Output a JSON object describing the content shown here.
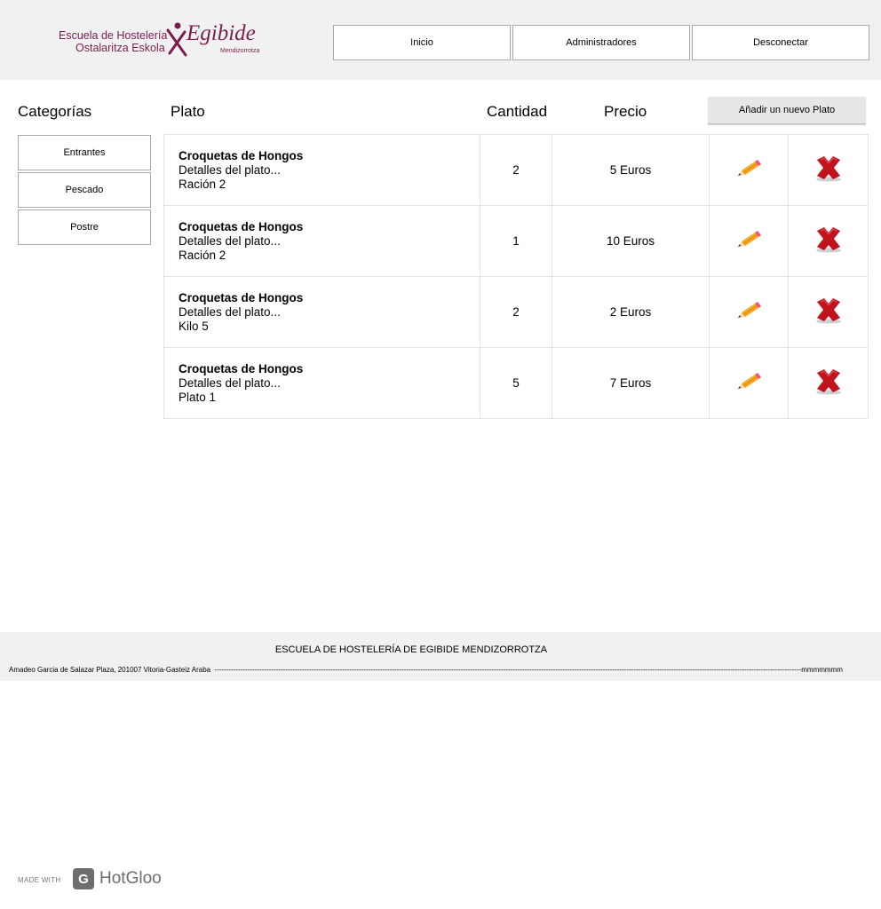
{
  "header": {
    "logo": {
      "line1": "Escuela de Hostelería",
      "line2": "Ostalaritza Eskola",
      "brand": "Egibide",
      "sub": "Mendizorrotza"
    },
    "nav": [
      {
        "label": "Inicio"
      },
      {
        "label": "Administradores"
      },
      {
        "label": "Desconectar"
      }
    ]
  },
  "sidebar": {
    "title": "Categorías",
    "items": [
      {
        "label": "Entrantes"
      },
      {
        "label": "Pescado"
      },
      {
        "label": "Postre"
      }
    ]
  },
  "table": {
    "headers": {
      "dish": "Plato",
      "qty": "Cantidad",
      "price": "Precio"
    },
    "add_button": "Añadir un nuevo Plato",
    "rows": [
      {
        "name": "Croquetas de Hongos",
        "details": "Detalles del plato...",
        "portion": "Ración 2",
        "qty": "2",
        "price": "5 Euros"
      },
      {
        "name": "Croquetas de Hongos",
        "details": "Detalles del plato...",
        "portion": "Ración 2",
        "qty": "1",
        "price": "10 Euros"
      },
      {
        "name": "Croquetas de Hongos",
        "details": "Detalles del plato...",
        "portion": "Kilo 5",
        "qty": "2",
        "price": "2 Euros"
      },
      {
        "name": "Croquetas de Hongos",
        "details": "Detalles del plato...",
        "portion": "Plato 1",
        "qty": "5",
        "price": "7 Euros"
      }
    ]
  },
  "footer": {
    "school": "ESCUELA DE HOSTELERÍA DE EGIBIDE MENDIZORROTZA",
    "address": "Amadeo Garcia de Salazar Plaza, 201007 Vitoria-Gasteiz Araba",
    "trail": "mmmmmmm"
  },
  "badge": {
    "made_with": "MADE WITH",
    "product": "HotGloo"
  },
  "icons": {
    "edit": "pencil-icon",
    "delete": "red-x-icon"
  },
  "colors": {
    "brand": "#7b1d4e",
    "header_bg": "#f1f1f1",
    "delete": "#c0141b"
  }
}
